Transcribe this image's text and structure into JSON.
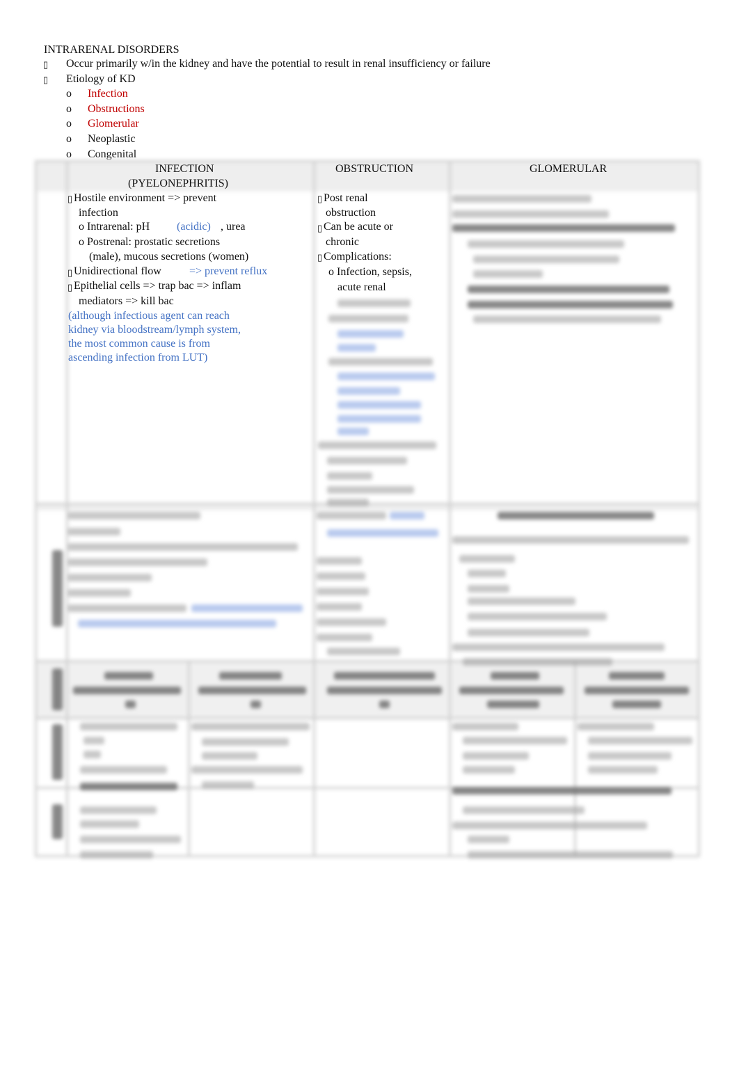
{
  "title": "INTRARENAL DISORDERS",
  "bullets": [
    {
      "text": "Occur primarily w/in the kidney and have the potential to result in renal insufficiency or failure"
    },
    {
      "text": "Etiology of KD"
    }
  ],
  "etiology": [
    {
      "text": "Infection",
      "color": "#c00000"
    },
    {
      "text": "Obstructions",
      "color": "#c00000"
    },
    {
      "text": "Glomerular",
      "color": "#c00000"
    },
    {
      "text": "Neoplastic",
      "color": "#111111"
    },
    {
      "text": "Congenital",
      "color": "#111111"
    }
  ],
  "table": {
    "headers": [
      "INFECTION",
      "(PYELONEPHRITIS)",
      "OBSTRUCTION",
      "GLOMERULAR"
    ],
    "infection": {
      "l1": "Hostile environment => prevent",
      "l2": "infection",
      "l3a": "o  Intrarenal: pH",
      "l3b": "(acidic)",
      "l3c": ", urea",
      "l4": "o  Postrenal: prostatic secretions",
      "l5": "(male), mucous secretions (women)",
      "l6a": "Unidirectional flow",
      "l6b": "=> prevent reflux",
      "l7": "Epithelial cells => trap bac => inflam",
      "l8": "mediators => kill bac",
      "note": [
        "(although infectious agent can reach",
        "kidney via bloodstream/lymph system,",
        "the most common cause is from",
        "ascending infection from LUT)"
      ]
    },
    "obstruction": {
      "l1": "Post renal",
      "l2": "obstruction",
      "l3": "Can be acute or",
      "l4": "chronic",
      "l5": "Complications:",
      "l6": "o Infection, sepsis,",
      "l7": "acute renal"
    }
  },
  "colors": {
    "accent_red": "#c00000",
    "accent_blue": "#4472c4"
  }
}
